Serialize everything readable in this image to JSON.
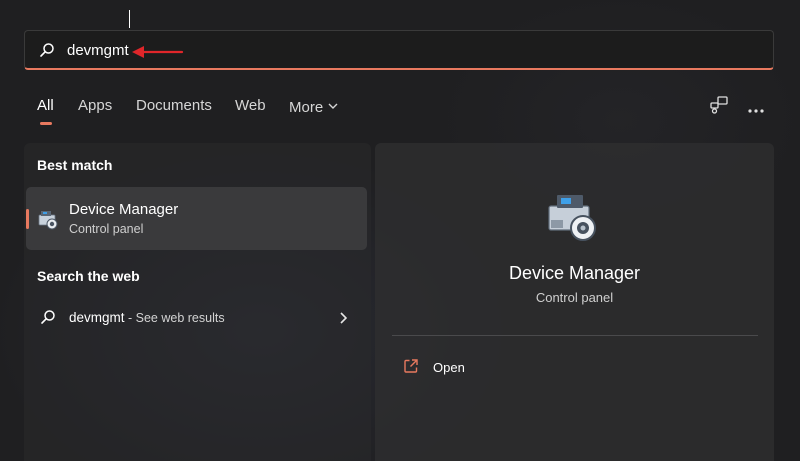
{
  "search": {
    "value": "devmgmt",
    "accent_color": "#e8795f"
  },
  "tabs": [
    {
      "label": "All",
      "active": true
    },
    {
      "label": "Apps"
    },
    {
      "label": "Documents"
    },
    {
      "label": "Web"
    },
    {
      "label": "More"
    }
  ],
  "top_icons": [
    "share-screen-icon",
    "more-options-icon"
  ],
  "best_match": {
    "heading": "Best match",
    "title": "Device Manager",
    "subtitle": "Control panel",
    "icon": "device-manager-icon"
  },
  "web_search": {
    "heading": "Search the web",
    "query": "devmgmt",
    "suffix": " - See web results"
  },
  "preview": {
    "title": "Device Manager",
    "subtitle": "Control panel",
    "action_label": "Open",
    "action_icon": "open-external-icon"
  }
}
